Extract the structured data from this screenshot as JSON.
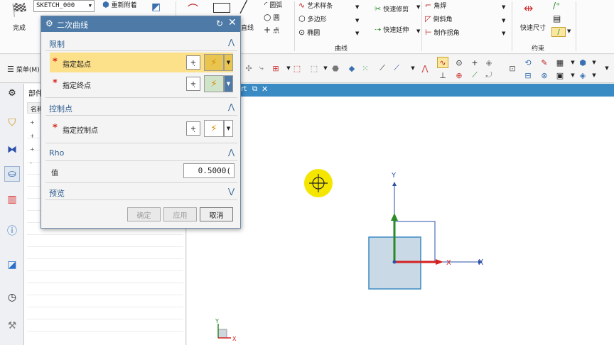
{
  "ribbon": {
    "finish_label": "完成",
    "sketch_name": "SKETCH_000",
    "reattach_label": "重新附着",
    "arc_label": "圆弧",
    "circle_label": "圆",
    "point_label": "点",
    "line_partial": "直线",
    "art_spline_label": "艺术样条",
    "polygon_label": "多边形",
    "ellipse_label": "椭圆",
    "quick_trim_label": "快速修剪",
    "quick_extend_label": "快速延伸",
    "corner_label": "角焊",
    "chamfer_label": "倒斜角",
    "make_corner_label": "制作拐角",
    "quick_dim_label": "快速尺寸",
    "curve_group_label": "曲线",
    "constraint_group_label": "约束"
  },
  "cmdbar": {
    "menu_label": "菜单(M)"
  },
  "navigator": {
    "title": "部件",
    "col_name": "名称"
  },
  "viewport": {
    "tab_label": "ort",
    "axis_x": "X",
    "axis_y": "Y"
  },
  "dialog": {
    "title": "二次曲线",
    "limits_section": "限制",
    "start_point_label": "指定起点",
    "end_point_label": "指定终点",
    "control_section": "控制点",
    "control_point_label": "指定控制点",
    "rho_section": "Rho",
    "value_label": "值",
    "value": "0.5000(",
    "preview_section": "预览",
    "ok_label": "确定",
    "apply_label": "应用",
    "cancel_label": "取消"
  },
  "colors": {
    "title_bar": "#4d7aa6",
    "active_row": "#fde08a",
    "section_text": "#2c5d8f",
    "required_star": "#d7261e",
    "cursor_highlight": "#f5e600",
    "axis_x_red": "#d32222",
    "axis_y_green": "#2a8a2a",
    "axis_blue": "#2b4fa8"
  }
}
